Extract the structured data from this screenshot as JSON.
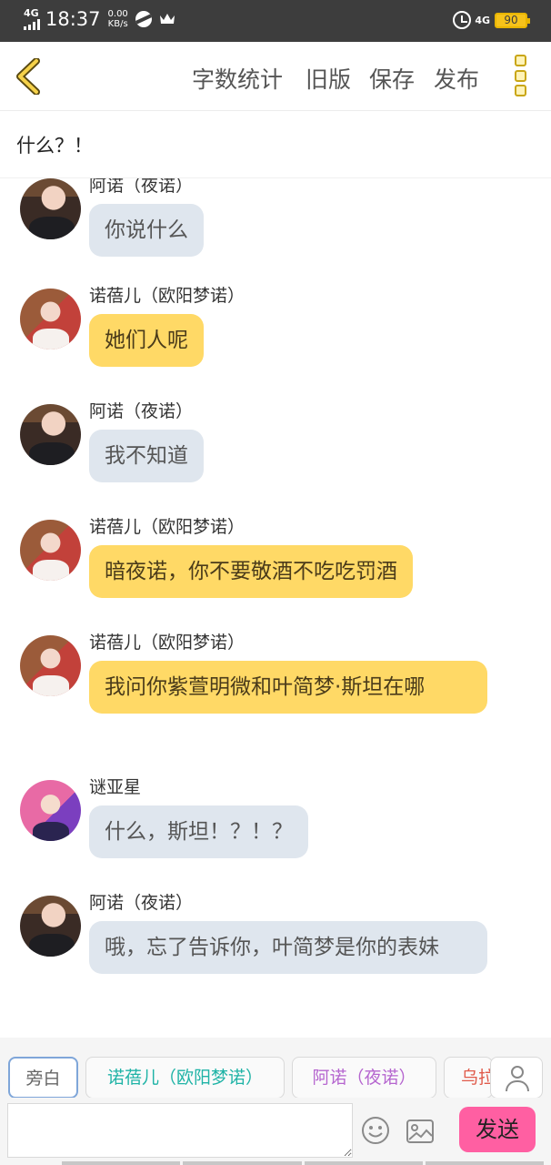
{
  "status_bar": {
    "network_left": "4G",
    "time": "18:37",
    "speed_value": "0.00",
    "speed_unit": "KB/s",
    "network_right": "4G",
    "battery": "90"
  },
  "toolbar": {
    "word_count": "字数统计",
    "old_version": "旧版",
    "save": "保存",
    "publish": "发布"
  },
  "title": "什么？！",
  "messages": [
    {
      "name": "阿诺（夜诺）",
      "text": "你说什么",
      "color": "#dfe6ee"
    },
    {
      "name": "诺蓓儿（欧阳梦诺）",
      "text": "她们人呢",
      "color": "#ffd966"
    },
    {
      "name": "阿诺（夜诺）",
      "text": "我不知道",
      "color": "#dfe6ee"
    },
    {
      "name": "诺蓓儿（欧阳梦诺）",
      "text": "暗夜诺，你不要敬酒不吃吃罚酒",
      "color": "#ffd966"
    },
    {
      "name": "诺蓓儿（欧阳梦诺）",
      "text": "我问你紫萱明微和叶简梦·斯坦在哪",
      "color": "#ffd966"
    },
    {
      "name": "谜亚星",
      "text": "什么，斯坦！？！？",
      "color": "#dfe6ee"
    },
    {
      "name": "阿诺（夜诺）",
      "text": "哦，忘了告诉你，叶简梦是你的表妹",
      "color": "#dfe6ee"
    }
  ],
  "roles": [
    "旁白",
    "诺蓓儿（欧阳梦诺）",
    "阿诺（夜诺）",
    "乌拉"
  ],
  "input": {
    "value": "",
    "send_label": "发送"
  },
  "colors": {
    "accent_yellow": "#ffd966",
    "send_pink": "#ff5fa2",
    "bubble_blue": "#dfe6ee"
  }
}
